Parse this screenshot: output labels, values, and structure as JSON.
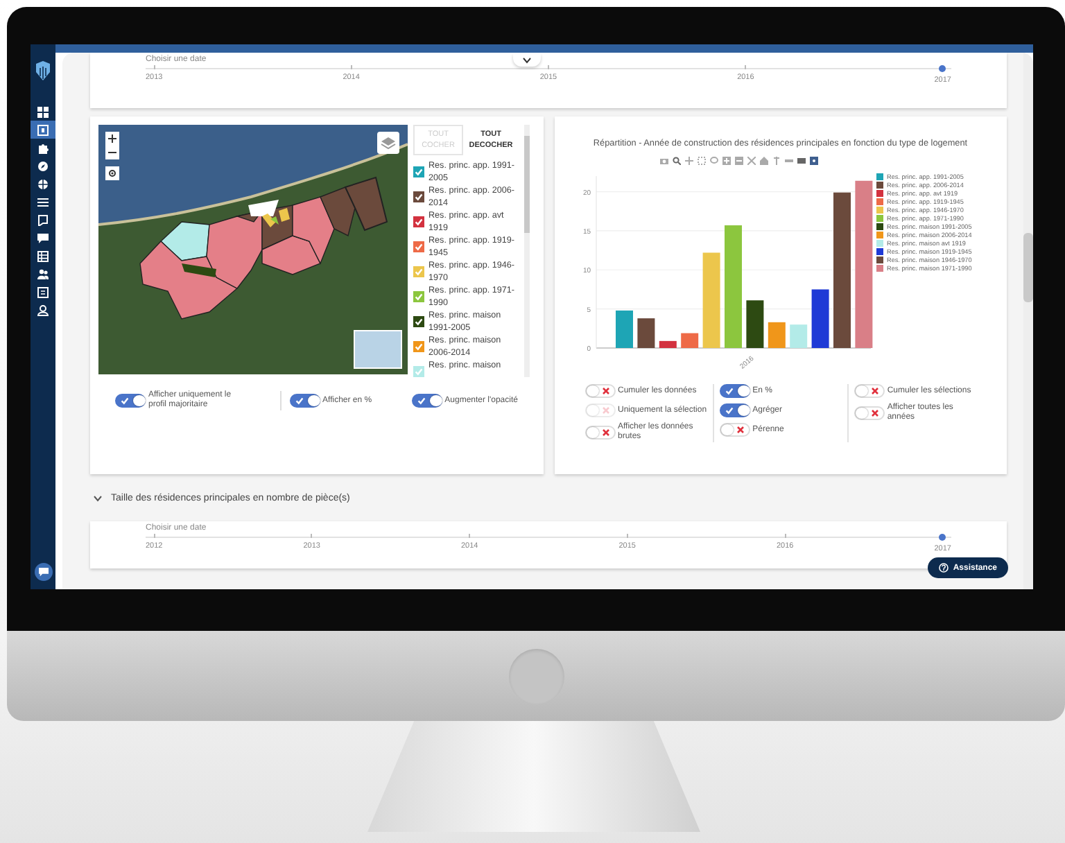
{
  "sidebar": {
    "items": [
      {
        "selected": false
      },
      {
        "selected": true
      },
      {
        "selected": false
      },
      {
        "selected": false
      },
      {
        "selected": false
      },
      {
        "selected": false
      },
      {
        "selected": false
      },
      {
        "selected": false
      },
      {
        "selected": false
      },
      {
        "selected": false
      },
      {
        "selected": false
      },
      {
        "selected": false
      }
    ]
  },
  "top_timeline": {
    "label": "Choisir une date",
    "years": [
      {
        "label": "2013",
        "selected": false
      },
      {
        "label": "2014",
        "selected": false
      },
      {
        "label": "2015",
        "selected": false
      },
      {
        "label": "2016",
        "selected": false
      },
      {
        "label": "2017",
        "selected": true
      }
    ]
  },
  "map_legend": {
    "check_all": {
      "label": "TOUT COCHER",
      "disabled": true
    },
    "uncheck_all": {
      "label": "TOUT DECOCHER",
      "disabled": false
    },
    "items": [
      {
        "label": "Res. princ. app. 1991-2005",
        "color": "#1ea5b5",
        "checked": true
      },
      {
        "label": "Res. princ. app. 2006-2014",
        "color": "#6b4a3c",
        "checked": true
      },
      {
        "label": "Res. princ. app. avt 1919",
        "color": "#d3323f",
        "checked": true
      },
      {
        "label": "Res. princ. app. 1919-1945",
        "color": "#ee6a47",
        "checked": true
      },
      {
        "label": "Res. princ. app. 1946-1970",
        "color": "#ecc64c",
        "checked": true
      },
      {
        "label": "Res. princ. app. 1971-1990",
        "color": "#8cc63e",
        "checked": true
      },
      {
        "label": "Res. princ. maison 1991-2005",
        "color": "#2d4a12",
        "checked": true
      },
      {
        "label": "Res. princ. maison 2006-2014",
        "color": "#f0961a",
        "checked": true
      },
      {
        "label": "Res. princ. maison",
        "color": "#b3ebe8",
        "checked": true
      }
    ]
  },
  "map_toggles": [
    {
      "label": "Afficher uniquement le profil majoritaire",
      "on": true,
      "disabled": false
    },
    {
      "label": "Afficher en %",
      "on": true,
      "disabled": false
    },
    {
      "label": "Augmenter l'opacité",
      "on": true,
      "disabled": false
    }
  ],
  "chart_panel": {
    "title": "Répartition - Année de construction des résidences principales en fonction du type de logement",
    "chart_data": {
      "type": "bar",
      "categories": [
        "2016"
      ],
      "yticks": [
        0,
        5,
        10,
        15,
        20
      ],
      "ylim": [
        0,
        22
      ],
      "grid": true,
      "series": [
        {
          "name": "Res. princ. app. 1991-2005",
          "color": "#1ea5b5",
          "values": [
            4.8
          ]
        },
        {
          "name": "Res. princ. app. 2006-2014",
          "color": "#6b4a3c",
          "values": [
            3.8
          ]
        },
        {
          "name": "Res. princ. app. avt 1919",
          "color": "#d3323f",
          "values": [
            0.9
          ]
        },
        {
          "name": "Res. princ. app. 1919-1945",
          "color": "#ee6a47",
          "values": [
            1.9
          ]
        },
        {
          "name": "Res. princ. app. 1946-1970",
          "color": "#ecc64c",
          "values": [
            12.2
          ]
        },
        {
          "name": "Res. princ. app. 1971-1990",
          "color": "#8cc63e",
          "values": [
            15.7
          ]
        },
        {
          "name": "Res. princ. maison 1991-2005",
          "color": "#2d4a12",
          "values": [
            6.1
          ]
        },
        {
          "name": "Res. princ. maison 2006-2014",
          "color": "#f0961a",
          "values": [
            3.3
          ]
        },
        {
          "name": "Res. princ. maison avt 1919",
          "color": "#b3ebe8",
          "values": [
            3.0
          ]
        },
        {
          "name": "Res. princ. maison 1919-1945",
          "color": "#1f3ad6",
          "values": [
            7.5
          ]
        },
        {
          "name": "Res. princ. maison 1946-1970",
          "color": "#6b4a3c",
          "values": [
            19.9
          ]
        },
        {
          "name": "Res. princ. maison 1971-1990",
          "color": "#d97f87",
          "values": [
            21.4
          ]
        }
      ]
    }
  },
  "chart_toggle_groups": [
    {
      "toggles": [
        {
          "label": "Cumuler les données",
          "on": false,
          "disabled": false
        },
        {
          "label": "Uniquement la sélection",
          "on": false,
          "disabled": true
        },
        {
          "label": "Afficher les données brutes",
          "on": false,
          "disabled": false
        }
      ]
    },
    {
      "toggles": [
        {
          "label": "En %",
          "on": true,
          "disabled": false
        },
        {
          "label": "Agréger",
          "on": true,
          "disabled": false
        },
        {
          "label": "Pérenne",
          "on": false,
          "disabled": false
        }
      ]
    },
    {
      "toggles": [
        {
          "label": "Cumuler les sélections",
          "on": false,
          "disabled": false
        },
        {
          "label": "Afficher toutes les années",
          "on": false,
          "disabled": false
        }
      ]
    }
  ],
  "section": {
    "title": "Taille des résidences principales en nombre de pièce(s)",
    "expanded": true
  },
  "bottom_timeline": {
    "label": "Choisir une date",
    "years": [
      {
        "label": "2012",
        "selected": false
      },
      {
        "label": "2013",
        "selected": false
      },
      {
        "label": "2014",
        "selected": false
      },
      {
        "label": "2015",
        "selected": false
      },
      {
        "label": "2016",
        "selected": false
      },
      {
        "label": "2017",
        "selected": true
      }
    ]
  },
  "assistance_button": {
    "label": "Assistance"
  }
}
